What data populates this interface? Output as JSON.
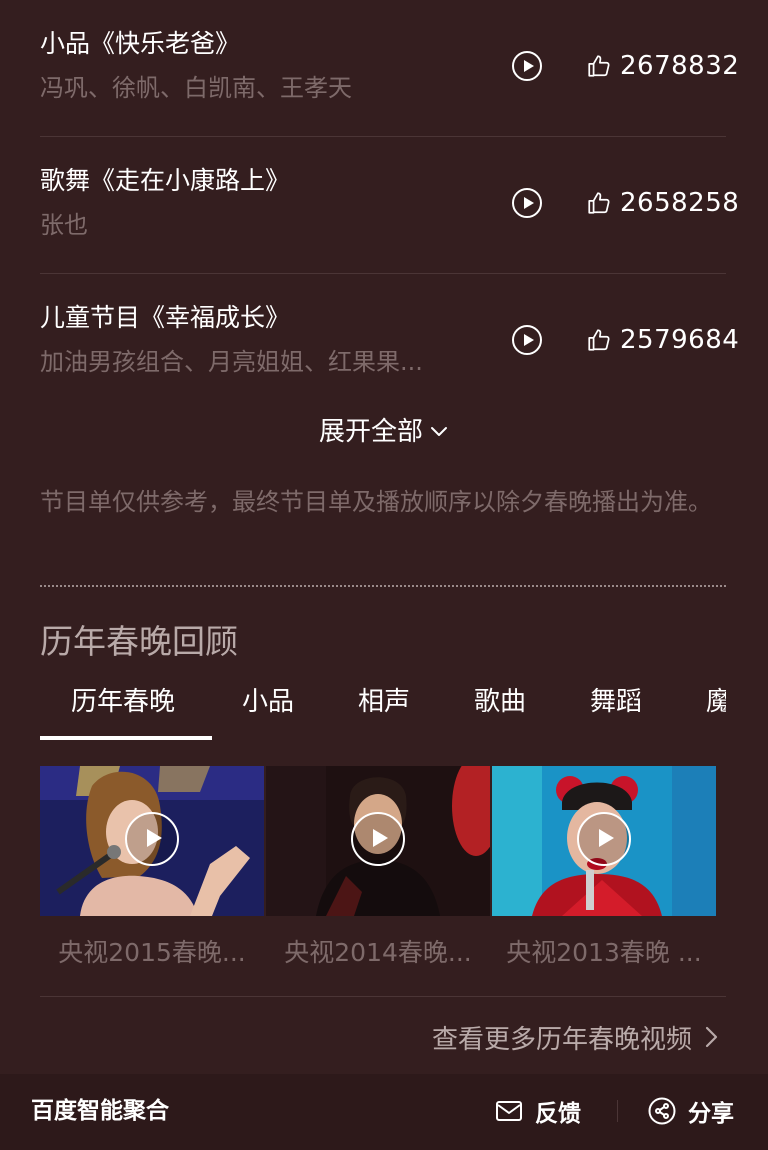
{
  "programs": [
    {
      "title": "小品《快乐老爸》",
      "performers": "冯巩、徐帆、白凯南、王孝天",
      "likes": "2678832"
    },
    {
      "title": "歌舞《走在小康路上》",
      "performers": "张也",
      "likes": "2658258"
    },
    {
      "title": "儿童节目《幸福成长》",
      "performers": "加油男孩组合、月亮姐姐、红果果...",
      "likes": "2579684"
    }
  ],
  "expand_label": "展开全部",
  "notice": "节目单仅供参考，最终节目单及播放顺序以除夕春晚播出为准。",
  "review": {
    "title": "历年春晚回顾",
    "tabs": [
      "历年春晚",
      "小品",
      "相声",
      "歌曲",
      "舞蹈",
      "魔"
    ],
    "active_tab": "历年春晚",
    "videos": [
      {
        "caption": "央视2015春晚..."
      },
      {
        "caption": "央视2014春晚..."
      },
      {
        "caption": "央视2013春晚 ..."
      }
    ],
    "more_label": "查看更多历年春晚视频"
  },
  "footer": {
    "brand": "百度智能聚合",
    "feedback": "反馈",
    "share": "分享"
  },
  "colors": {
    "background": "#341e1f",
    "footer_background": "#2d191a",
    "muted_text": "#7e6a6a",
    "primary_text": "#ffffff"
  },
  "icons": {
    "play": "play-circle-icon",
    "like": "thumbs-up-icon",
    "expand": "chevron-down-icon",
    "more": "chevron-right-icon",
    "feedback": "envelope-icon",
    "share": "share-icon"
  }
}
